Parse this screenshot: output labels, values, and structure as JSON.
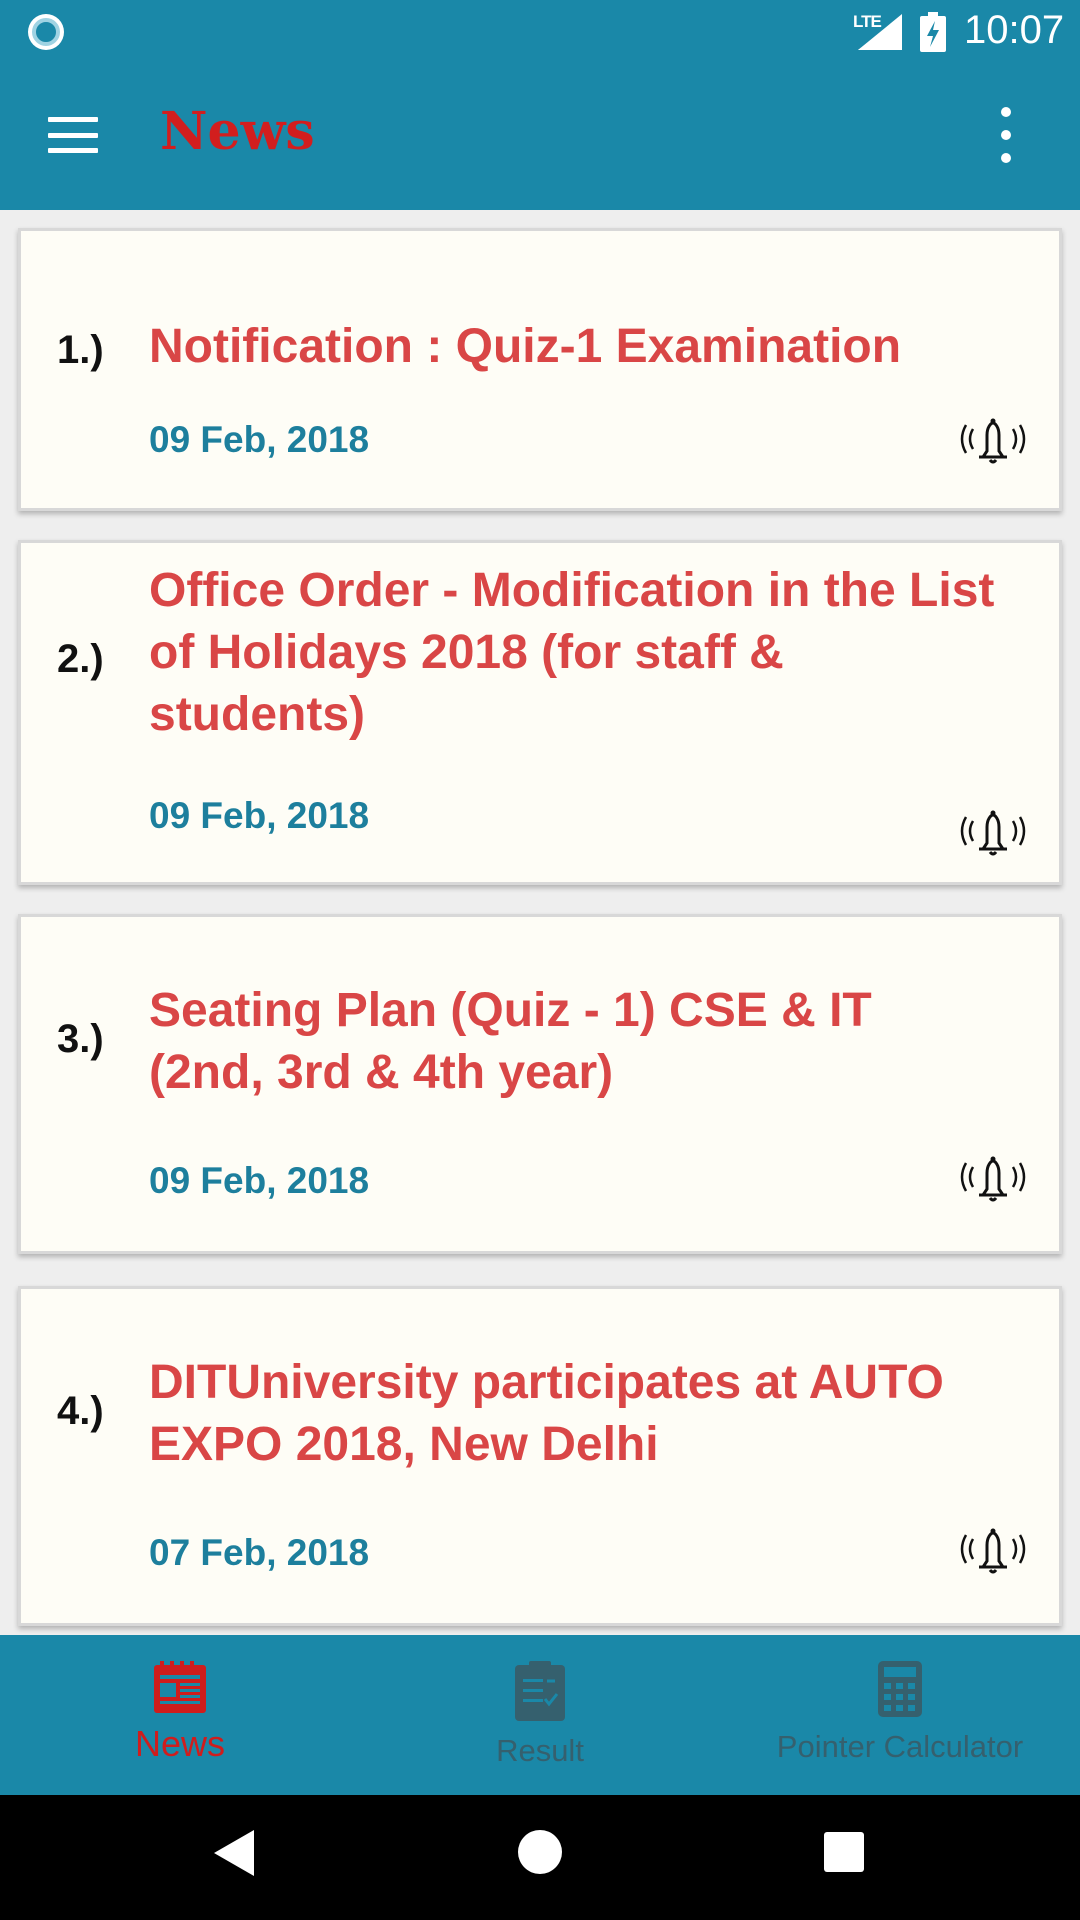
{
  "status_bar": {
    "network_label": "LTE",
    "time": "10:07"
  },
  "toolbar": {
    "title": "News"
  },
  "news": [
    {
      "number": "1.)",
      "title": "Notification : Quiz-1 Examination",
      "date": "09 Feb, 2018"
    },
    {
      "number": "2.)",
      "title": "Office Order - Modification in the List of Holidays 2018 (for staff & students)",
      "date": "09 Feb, 2018"
    },
    {
      "number": "3.)",
      "title": "Seating Plan (Quiz - 1) CSE & IT (2nd, 3rd & 4th year)",
      "date": "09 Feb, 2018"
    },
    {
      "number": "4.)",
      "title": "DITUniversity participates at AUTO EXPO 2018, New Delhi",
      "date": "07 Feb, 2018"
    }
  ],
  "bottom_nav": {
    "items": [
      {
        "label": "News",
        "icon": "newspaper-icon",
        "active": true
      },
      {
        "label": "Result",
        "icon": "clipboard-icon",
        "active": false
      },
      {
        "label": "Pointer Calculator",
        "icon": "calculator-icon",
        "active": false
      }
    ]
  },
  "colors": {
    "primary": "#1a88a8",
    "accent": "#d21e1e",
    "title_text": "#d94646",
    "date_text": "#1d7f9d",
    "card_background": "#fefdf6"
  }
}
